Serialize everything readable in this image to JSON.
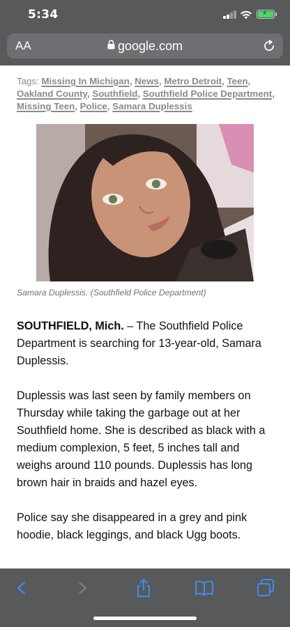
{
  "status_bar": {
    "time": "5:34"
  },
  "url_bar": {
    "text_size_label": "AA",
    "domain": "google.com",
    "lock_icon": "lock-icon",
    "reload_icon": "reload-icon"
  },
  "article": {
    "tags_label": "Tags:",
    "tags": [
      "Missing In Michigan",
      "News",
      "Metro Detroit",
      "Teen",
      "Oakland County",
      "Southfield",
      "Southfield Police Department",
      "Missing Teen",
      "Police",
      "Samara Duplessis"
    ],
    "photo_caption": "Samara Duplessis. (Southfield Police Department)",
    "lead_dateline": "SOUTHFIELD, Mich.",
    "paragraph_1_rest": " – The Southfield Police Department is searching for 13-year-old, Samara Duplessis.",
    "paragraph_2": "Duplessis was last seen by family members on Thursday while taking the garbage out at her Southfield home. She is described as black with a medium complexion, 5 feet, 5 inches tall and weighs around 110 pounds. Duplessis has long brown hair in braids and hazel eyes.",
    "paragraph_3": "Police say she disappeared in a grey and pink hoodie, black leggings, and black Ugg boots."
  },
  "toolbar": {
    "back_icon": "chevron-left-icon",
    "forward_icon": "chevron-right-icon",
    "share_icon": "share-icon",
    "bookmarks_icon": "book-icon",
    "tabs_icon": "tabs-icon"
  },
  "colors": {
    "chrome": "#58595b",
    "url_field": "#6e6f72",
    "toolbar_accent": "#3b8ef0",
    "battery": "#4cd964"
  }
}
